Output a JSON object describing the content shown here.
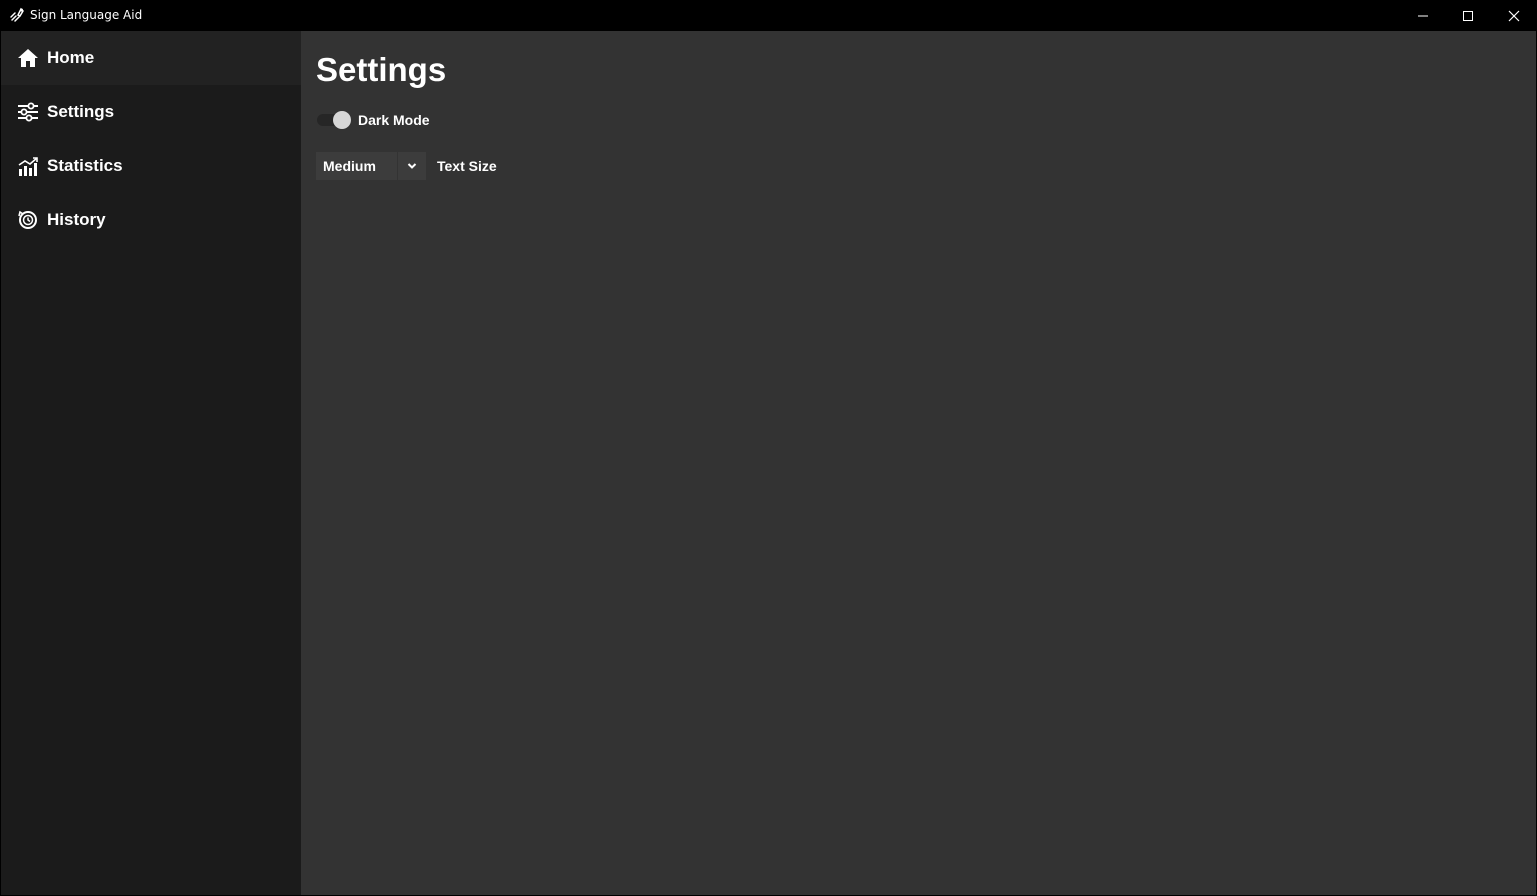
{
  "window": {
    "title": "Sign Language Aid",
    "icon": "sign-language-icon",
    "controls": {
      "minimize": "minimize-icon",
      "maximize": "maximize-icon",
      "close": "close-icon"
    }
  },
  "sidebar": {
    "items": [
      {
        "label": "Home",
        "icon": "home-icon",
        "active": true
      },
      {
        "label": "Settings",
        "icon": "sliders-icon",
        "active": false
      },
      {
        "label": "Statistics",
        "icon": "chart-icon",
        "active": false
      },
      {
        "label": "History",
        "icon": "history-icon",
        "active": false
      }
    ]
  },
  "main": {
    "title": "Settings",
    "dark_mode": {
      "label": "Dark Mode",
      "enabled": true
    },
    "text_size": {
      "selected": "Medium",
      "label": "Text Size"
    }
  },
  "colors": {
    "titlebar_bg": "#000000",
    "sidebar_bg": "#1b1b1b",
    "sidebar_active_bg": "#222222",
    "main_bg": "#333333",
    "select_bg": "#3c3c3c",
    "text": "#ffffff"
  }
}
